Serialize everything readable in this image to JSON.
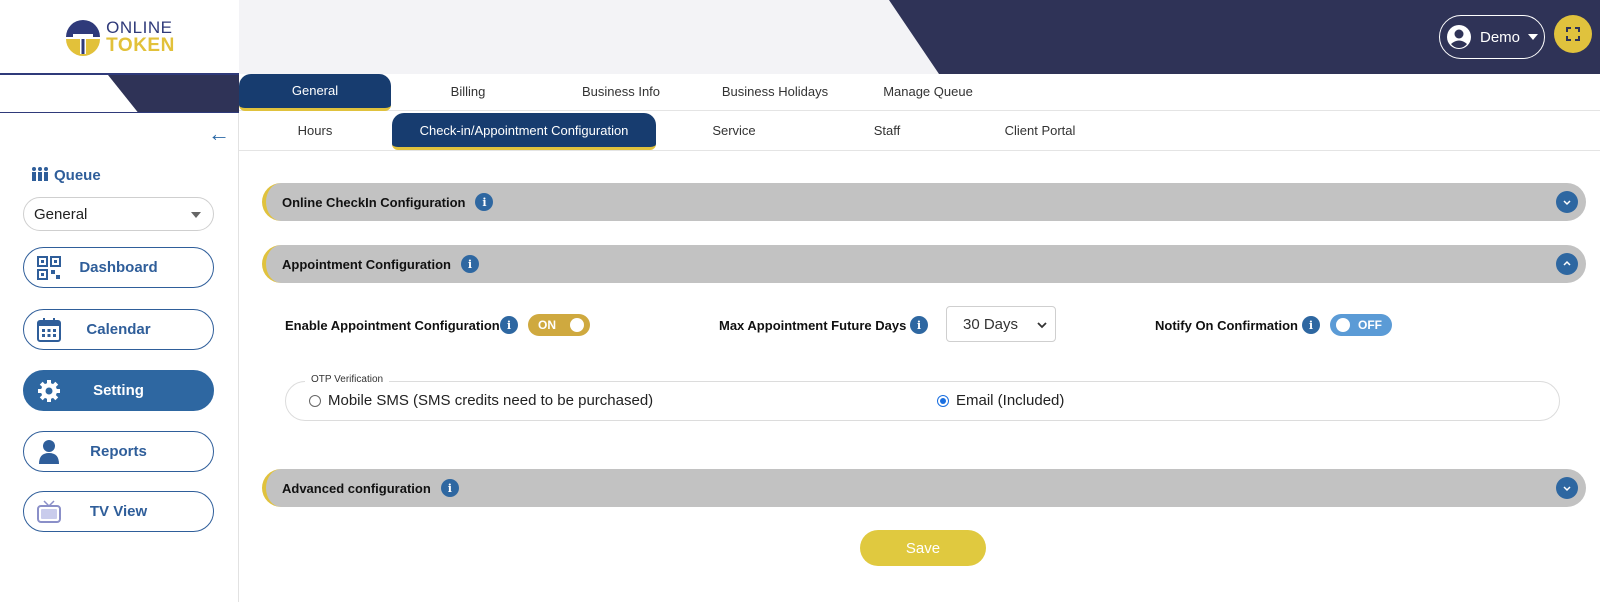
{
  "brand": {
    "line1": "ONLINE",
    "line2": "TOKEN"
  },
  "header": {
    "user_label": "Demo",
    "user_icon": "user-circle-icon",
    "fullscreen_icon": "fullscreen-icon"
  },
  "colors": {
    "navy": "#2f3357",
    "accent": "#e0c23d",
    "primary": "#2e67a1",
    "tab_active": "#173c6f",
    "section_bar": "#c2c2c2"
  },
  "sidebar": {
    "queue_label": "Queue",
    "queue_value": "General",
    "items": [
      {
        "label": "Dashboard",
        "icon": "qr-code-icon"
      },
      {
        "label": "Calendar",
        "icon": "calendar-icon"
      },
      {
        "label": "Setting",
        "icon": "gear-icon"
      },
      {
        "label": "Reports",
        "icon": "person-icon"
      },
      {
        "label": "TV View",
        "icon": "tv-icon"
      }
    ]
  },
  "tabs_primary": [
    "General",
    "Billing",
    "Business Info",
    "Business Holidays",
    "Manage Queue"
  ],
  "tabs_secondary": [
    "Hours",
    "Check-in/Appointment Configuration",
    "Service",
    "Staff",
    "Client Portal"
  ],
  "sections": {
    "online_checkin": "Online CheckIn Configuration",
    "appointment": "Appointment Configuration",
    "advanced": "Advanced configuration"
  },
  "appointment": {
    "enable_label": "Enable Appointment Configuration",
    "enable_state": "ON",
    "max_days_label": "Max Appointment Future Days",
    "max_days_value": "30 Days",
    "notify_label": "Notify On Confirmation",
    "notify_state": "OFF"
  },
  "otp": {
    "legend": "OTP Verification",
    "option_sms": "Mobile SMS (SMS credits need to be purchased)",
    "option_email": "Email (Included)",
    "selected": "email"
  },
  "save_label": "Save"
}
